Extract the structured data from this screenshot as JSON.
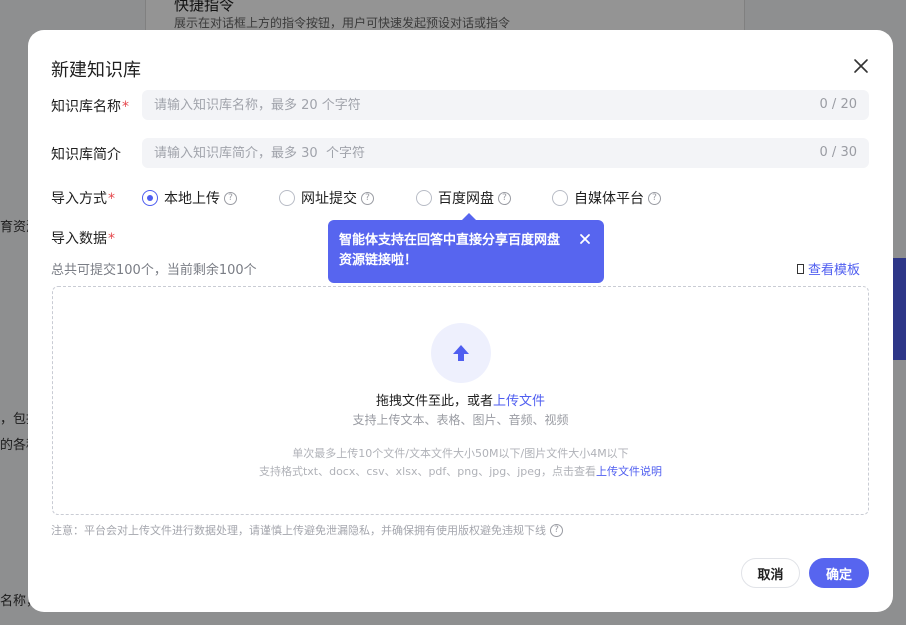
{
  "background": {
    "card_title": "快捷指令",
    "card_desc": "展示在对话框上方的指令按钮，用户可快速发起预设对话或指令",
    "frag_1": "育资源",
    "frag_2": "，包括",
    "frag_3": "的各种",
    "frag_4": "名称，"
  },
  "modal": {
    "title": "新建知识库",
    "name": {
      "label": "知识库名称",
      "required": "*",
      "placeholder": "请输入知识库名称，最多 20 个字符",
      "counter": "0 / 20"
    },
    "desc": {
      "label": "知识库简介",
      "placeholder": "请输入知识库简介，最多 30  个字符",
      "counter": "0 / 30"
    },
    "import_method": {
      "label": "导入方式",
      "required": "*",
      "options": [
        {
          "label": "本地上传",
          "checked": true
        },
        {
          "label": "网址提交",
          "checked": false
        },
        {
          "label": "百度网盘",
          "checked": false
        },
        {
          "label": "自媒体平台",
          "checked": false
        }
      ]
    },
    "tooltip": "智能体支持在回答中直接分享百度网盘资源链接啦！",
    "import_data": {
      "label": "导入数据",
      "required": "*",
      "quota": "总共可提交100个，当前剩余100个",
      "template_link": "查看模板"
    },
    "dropzone": {
      "main_text": "拖拽文件至此，或者",
      "main_link": "上传文件",
      "sub_text": "支持上传文本、表格、图片、音频、视频",
      "limit_text": "单次最多上传10个文件/文本文件大小50M以下/图片文件大小4M以下",
      "formats_text": "支持格式txt、docx、csv、xlsx、pdf、png、jpg、jpeg，点击查看",
      "formats_link": "上传文件说明"
    },
    "notice": "注意：平台会对上传文件进行数据处理，请谨慎上传避免泄漏隐私，并确保拥有使用版权避免违规下线",
    "cancel_label": "取消",
    "confirm_label": "确定"
  },
  "colors": {
    "accent": "#5765ef",
    "required": "#e5484d",
    "overlay": "rgba(0,0,0,0.42)"
  }
}
